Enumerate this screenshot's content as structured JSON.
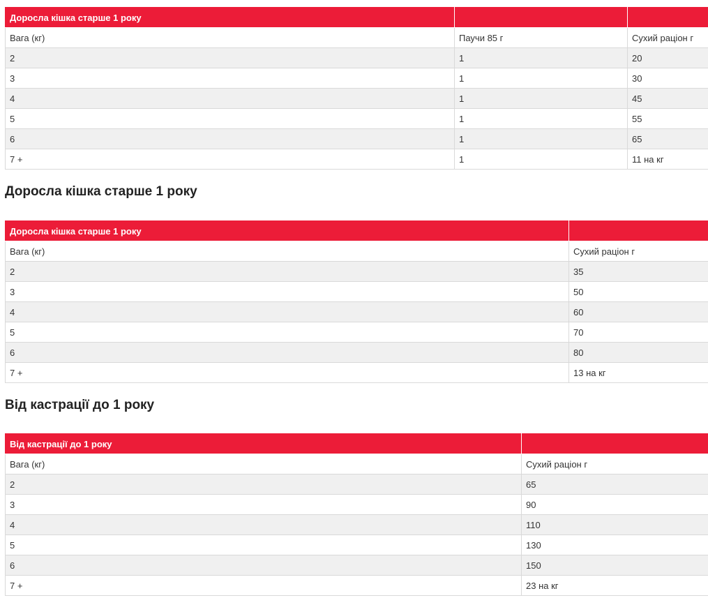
{
  "table1": {
    "title": "Доросла кішка старше 1 року",
    "headers": [
      "Вага (кг)",
      "Паучи 85 г",
      "Сухий раціон г"
    ],
    "rows": [
      [
        "2",
        "1",
        "20"
      ],
      [
        "3",
        "1",
        "30"
      ],
      [
        "4",
        "1",
        "45"
      ],
      [
        "5",
        "1",
        "55"
      ],
      [
        "6",
        "1",
        "65"
      ],
      [
        "7 +",
        "1",
        "11 на кг"
      ]
    ]
  },
  "heading2": "Доросла кішка старше 1 року",
  "table2": {
    "title": "Доросла кішка старше 1 року",
    "headers": [
      "Вага (кг)",
      "Сухий раціон г"
    ],
    "rows": [
      [
        "2",
        "35"
      ],
      [
        "3",
        "50"
      ],
      [
        "4",
        "60"
      ],
      [
        "5",
        "70"
      ],
      [
        "6",
        "80"
      ],
      [
        "7 +",
        "13 на кг"
      ]
    ]
  },
  "heading3": "Від кастрації до 1 року",
  "table3": {
    "title": "Від кастрації до 1 року",
    "headers": [
      "Вага (кг)",
      "Сухий раціон г"
    ],
    "rows": [
      [
        "2",
        "65"
      ],
      [
        "3",
        "90"
      ],
      [
        "4",
        "110"
      ],
      [
        "5",
        "130"
      ],
      [
        "6",
        "150"
      ],
      [
        "7 +",
        "23 на кг"
      ]
    ]
  },
  "colors": {
    "header_bg": "#ec1c38",
    "header_text": "#ffffff",
    "stripe": "#f0f0f0"
  }
}
